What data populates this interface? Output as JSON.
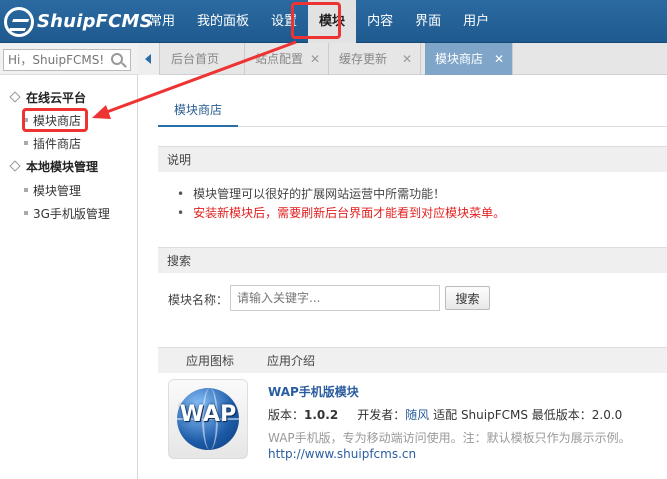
{
  "app": {
    "logo_text": "ShuipFCMS"
  },
  "topnav": {
    "items": [
      "常用",
      "我的面板",
      "设置",
      "模块",
      "内容",
      "界面",
      "用户"
    ],
    "active_index": 3
  },
  "sidebar_search": {
    "placeholder": "Hi，ShuipFCMS!"
  },
  "tabs": [
    {
      "label": "后台首页",
      "closable": false
    },
    {
      "label": "站点配置",
      "closable": true
    },
    {
      "label": "缓存更新",
      "closable": true
    },
    {
      "label": "模块商店",
      "closable": true,
      "active": true
    }
  ],
  "sidebar": {
    "groups": [
      {
        "title": "在线云平台",
        "items": [
          "模块商店",
          "插件商店"
        ]
      },
      {
        "title": "本地模块管理",
        "items": [
          "模块管理",
          "3G手机版管理"
        ]
      }
    ],
    "selected_item": "模块商店"
  },
  "main": {
    "subtab": "模块商店",
    "notice": {
      "title": "说明",
      "lines": [
        "模块管理可以很好的扩展网站运营中所需功能！",
        "安装新模块后，需要刷新后台界面才能看到对应模块菜单。"
      ]
    },
    "search": {
      "title": "搜索",
      "label": "模块名称：",
      "placeholder": "请输入关键字...",
      "button": "搜索"
    },
    "table": {
      "headers": [
        "应用图标",
        "应用介绍"
      ],
      "rows": [
        {
          "icon_text": "WAP",
          "icon": "wap-globe-icon",
          "title": "WAP手机版模块",
          "version_label": "版本：",
          "version": "1.0.2",
          "developer_label": "开发者：",
          "developer": "随风",
          "compat_text": "适配 ShuipFCMS 最低版本：2.0.0",
          "description": "WAP手机版，专为移动端访问使用。注：默认模板只作为展示示例。",
          "url": "http://www.shuipfcms.cn"
        }
      ]
    }
  },
  "colors": {
    "topbar": "#2566a0",
    "highlight": "#e33333",
    "link": "#2a5d9f",
    "warning": "#e02020"
  }
}
